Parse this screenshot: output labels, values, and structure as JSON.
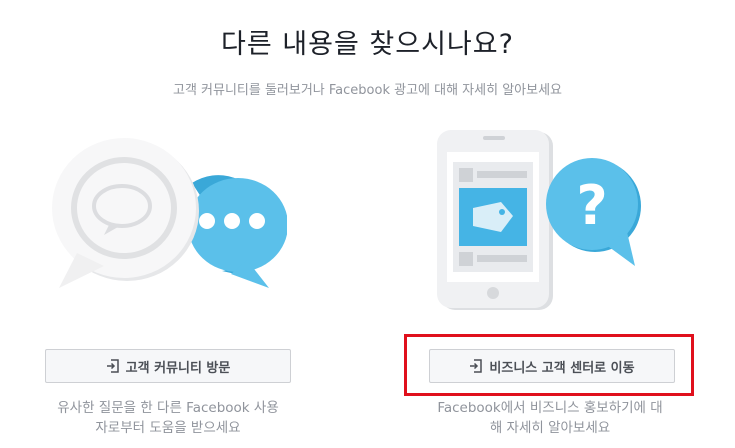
{
  "header": {
    "title": "다른 내용을 찾으시나요?",
    "subtitle": "고객 커뮤니티를 둘러보거나 Facebook 광고에 대해 자세히 알아보세요"
  },
  "left_option": {
    "illustration": "chat-bubbles-illustration",
    "button_icon": "enter-icon",
    "button_label": "고객 커뮤니티 방문",
    "description_line1": "유사한 질문을 한 다른 Facebook 사용",
    "description_line2": "자로부터 도움을 받으세요"
  },
  "right_option": {
    "illustration": "phone-question-illustration",
    "button_icon": "enter-icon",
    "button_label": "비즈니스 고객 센터로 이동",
    "description_line1": "Facebook에서 비즈니스 홍보하기에 대",
    "description_line2": "해 자세히 알아보세요"
  },
  "colors": {
    "accent_blue": "#45b4e5",
    "highlight_red": "#e0101c",
    "button_bg": "#f6f7f9",
    "muted_text": "#90949c"
  }
}
